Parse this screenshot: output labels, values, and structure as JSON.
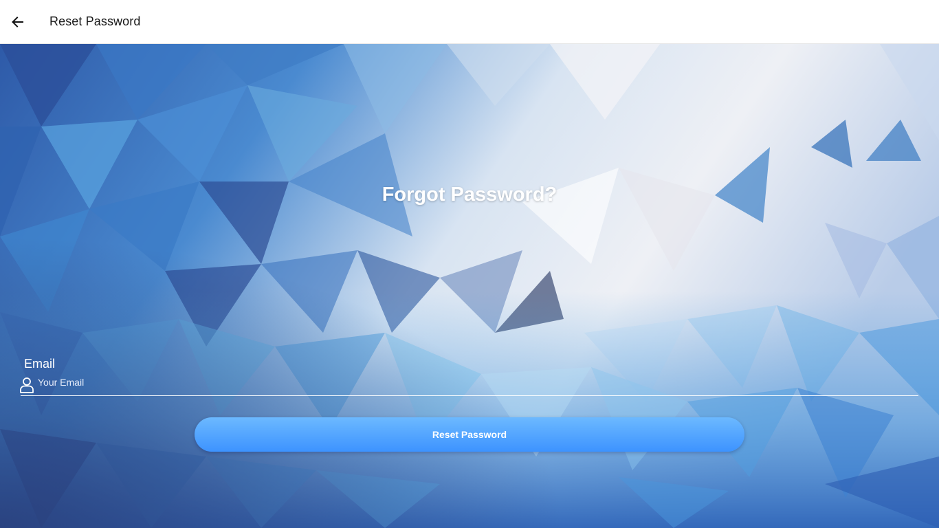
{
  "header": {
    "back_icon": "arrow-left-icon",
    "title": "Reset Password"
  },
  "main": {
    "heading": "Forgot Password?",
    "email_label": "Email",
    "email_icon": "user-icon",
    "email_value": "",
    "email_placeholder": "Your Email",
    "submit_label": "Reset Password"
  },
  "colors": {
    "button_top": "#6cb9ff",
    "button_bottom": "#3d93ff",
    "background_dark": "#2f58a8",
    "background_light": "#eef1f7"
  }
}
